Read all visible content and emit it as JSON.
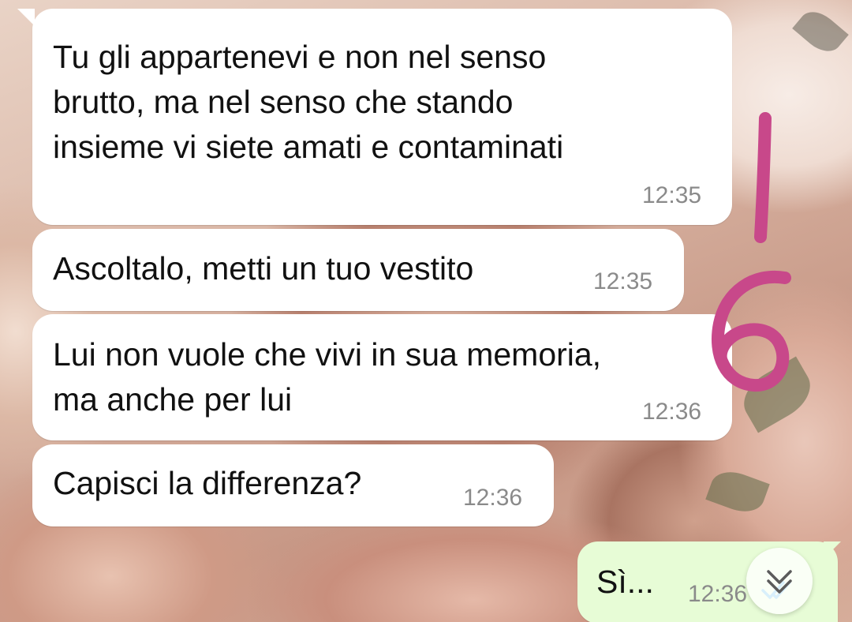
{
  "messages": [
    {
      "direction": "incoming",
      "lines": [
        "Tu gli appartenevi e non nel senso",
        "brutto, ma nel senso che stando",
        "insieme vi siete amati e contaminati"
      ],
      "time": "12:35"
    },
    {
      "direction": "incoming",
      "lines": [
        "Ascoltalo, metti un tuo vestito"
      ],
      "time": "12:35"
    },
    {
      "direction": "incoming",
      "lines": [
        "Lui non vuole che vivi in sua memoria,",
        "ma anche per lui"
      ],
      "time": "12:36"
    },
    {
      "direction": "incoming",
      "lines": [
        "Capisci la differenza?"
      ],
      "time": "12:36"
    },
    {
      "direction": "outgoing",
      "lines": [
        "Sì..."
      ],
      "time": "12:36",
      "status": "read"
    }
  ],
  "annotation": {
    "text": "16",
    "color": "#c8488a"
  },
  "icons": {
    "scroll_down": "double-chevron-down-icon",
    "read_receipt": "double-check-icon"
  },
  "colors": {
    "incoming_bubble": "#ffffff",
    "outgoing_bubble": "#e7fcd6",
    "timestamp": "#8a8a8a",
    "read_ticks": "#4fb6ec"
  }
}
